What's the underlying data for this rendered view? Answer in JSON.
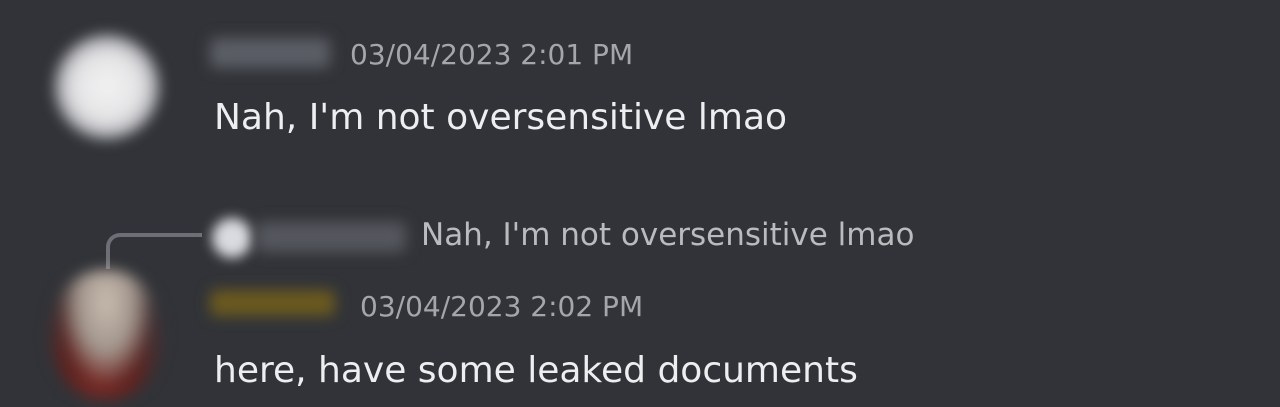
{
  "messages": [
    {
      "timestamp": "03/04/2023 2:01 PM",
      "text": "Nah, I'm not oversensitive lmao"
    },
    {
      "reply_preview": "Nah, I'm not oversensitive lmao",
      "timestamp": "03/04/2023 2:02 PM",
      "text": "here, have some leaked documents"
    }
  ]
}
